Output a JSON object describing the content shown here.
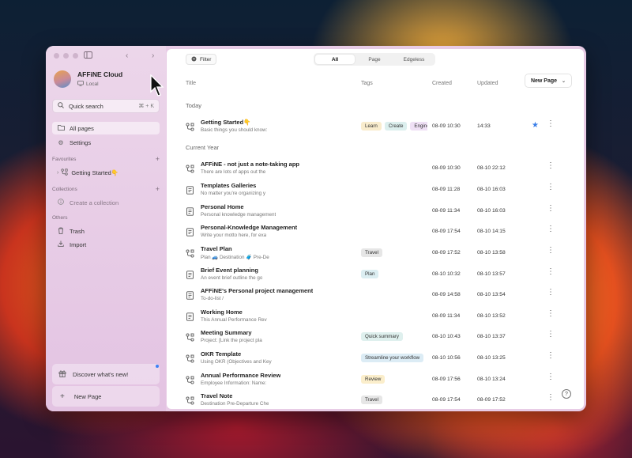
{
  "colors": {
    "tag_learn": "#f9eccd",
    "tag_create": "#dcefee",
    "tag_eng": "#efe0f5",
    "tag_travel": "#e6e6e6",
    "tag_plan": "#dceef2",
    "tag_quick": "#dff0ee",
    "tag_streamline": "#dcecf5",
    "tag_review": "#fbeecb",
    "star": "#3a7ee8"
  },
  "sidebar": {
    "workspace_name": "AFFiNE Cloud",
    "workspace_sub": "Local",
    "quick_search": "Quick search",
    "quick_search_kbd": "⌘ + K",
    "all_pages": "All pages",
    "settings": "Settings",
    "favourites_label": "Favourites",
    "favourite_item": "Getting Started👇",
    "collections_label": "Collections",
    "create_collection": "Create a collection",
    "others_label": "Others",
    "trash": "Trash",
    "import": "Import",
    "discover": "Discover what's new!",
    "new_page": "New Page"
  },
  "toolbar": {
    "filter": "Filter",
    "segments": [
      "All",
      "Page",
      "Edgeless"
    ]
  },
  "columns": {
    "title": "Title",
    "tags": "Tags",
    "created": "Created",
    "updated": "Updated",
    "new_page": "New Page"
  },
  "groups": {
    "today": "Today",
    "current_year": "Current Year"
  },
  "rows": [
    {
      "title": "Getting Started👇",
      "preview": "Basic things you should know:",
      "tags": [
        "Learn",
        "Create",
        "Engineering"
      ],
      "created": "08-09 10:30",
      "updated": "14:33",
      "type": "edgeless"
    },
    {
      "title": "AFFiNE - not just a note-taking app",
      "preview": "There are lots of apps out the",
      "tags": [],
      "created": "08-09 10:30",
      "updated": "08-10 22:12",
      "type": "edgeless"
    },
    {
      "title": "Templates Galleries",
      "preview": "No matter you're organizing y",
      "tags": [],
      "created": "08-09 11:28",
      "updated": "08-10 16:03",
      "type": "page"
    },
    {
      "title": "Personal Home",
      "preview": "Personal knowledge management",
      "tags": [],
      "created": "08-09 11:34",
      "updated": "08-10 16:03",
      "type": "page"
    },
    {
      "title": "Personal-Knowledge Management",
      "preview": "Write your motto here, for exa",
      "tags": [],
      "created": "08-09 17:54",
      "updated": "08-10 14:15",
      "type": "page"
    },
    {
      "title": "Travel Plan",
      "preview": "Plan 🚙 Destination 🧳 Pre-De",
      "tags": [
        "Travel"
      ],
      "created": "08-09 17:52",
      "updated": "08-10 13:58",
      "type": "edgeless"
    },
    {
      "title": "Brief Event planning",
      "preview": "An event brief outline the go",
      "tags": [
        "Plan"
      ],
      "created": "08-10 10:32",
      "updated": "08-10 13:57",
      "type": "page"
    },
    {
      "title": "AFFiNE's Personal project management",
      "preview": "To-do-list /",
      "tags": [],
      "created": "08-09 14:58",
      "updated": "08-10 13:54",
      "type": "page"
    },
    {
      "title": "Working Home",
      "preview": "This Annual Performance Rev",
      "tags": [],
      "created": "08-09 11:34",
      "updated": "08-10 13:52",
      "type": "page"
    },
    {
      "title": "Meeting Summary",
      "preview": "Project: [Link the project pla",
      "tags": [
        "Quick summary"
      ],
      "created": "08-10 10:43",
      "updated": "08-10 13:37",
      "type": "edgeless"
    },
    {
      "title": "OKR Template",
      "preview": "Using OKR (Objectives and Key",
      "tags": [
        "Streamline your workflow"
      ],
      "created": "08-10 10:56",
      "updated": "08-10 13:25",
      "type": "edgeless"
    },
    {
      "title": "Annual Performance Review",
      "preview": "Employee Information: Name:",
      "tags": [
        "Review"
      ],
      "created": "08-09 17:56",
      "updated": "08-10 13:24",
      "type": "edgeless"
    },
    {
      "title": "Travel Note",
      "preview": "Destination Pre-Departure Che",
      "tags": [
        "Travel"
      ],
      "created": "08-09 17:54",
      "updated": "08-09 17:52",
      "type": "edgeless"
    }
  ]
}
